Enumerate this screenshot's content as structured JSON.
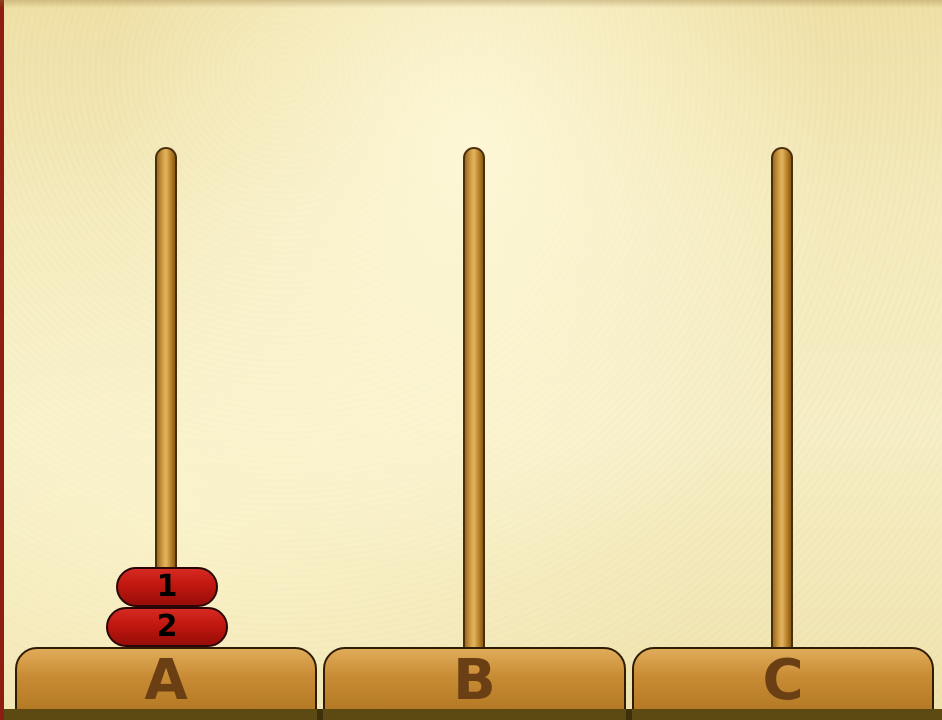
{
  "pegs": [
    {
      "label": "A",
      "disks": [
        "1",
        "2"
      ]
    },
    {
      "label": "B",
      "disks": []
    },
    {
      "label": "C",
      "disks": []
    }
  ],
  "colors": {
    "disk": "#c01710",
    "peg": "#d6a24a",
    "base": "#c98c35",
    "base_label": "#6a3f14",
    "background": "#f4eabd"
  }
}
